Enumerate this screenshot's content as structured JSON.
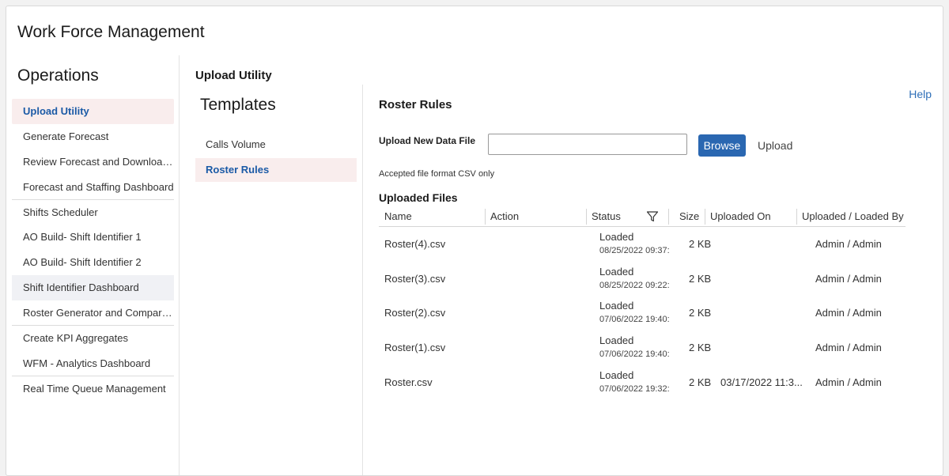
{
  "app": {
    "title": "Work Force Management"
  },
  "sidebar": {
    "title": "Operations",
    "items": [
      {
        "label": "Upload Utility"
      },
      {
        "label": "Generate Forecast"
      },
      {
        "label": "Review Forecast and Download Forecast"
      },
      {
        "label": "Forecast and Staffing Dashboard"
      },
      {
        "label": "Shifts Scheduler"
      },
      {
        "label": "AO Build- Shift Identifier 1"
      },
      {
        "label": "AO Build- Shift Identifier 2"
      },
      {
        "label": "Shift Identifier Dashboard"
      },
      {
        "label": "Roster Generator and Comparison"
      },
      {
        "label": "Create KPI Aggregates"
      },
      {
        "label": "WFM - Analytics Dashboard"
      },
      {
        "label": "Real Time Queue Management"
      }
    ]
  },
  "page": {
    "title": "Upload Utility",
    "help": "Help"
  },
  "templates": {
    "title": "Templates",
    "items": [
      {
        "label": "Calls Volume"
      },
      {
        "label": "Roster Rules"
      }
    ]
  },
  "upload": {
    "section_title": "Roster Rules",
    "label": "Upload New Data File",
    "file_value": "",
    "browse_label": "Browse",
    "upload_label": "Upload",
    "note": "Accepted file format CSV only"
  },
  "files": {
    "title": "Uploaded Files",
    "columns": [
      "Name",
      "Action",
      "Status",
      "Size",
      "Uploaded On",
      "Uploaded / Loaded By"
    ],
    "rows": [
      {
        "name": "Roster(4).csv",
        "status": "Loaded",
        "status_time": "08/25/2022 09:37:",
        "size": "2 KB",
        "uploaded_on": "",
        "by": "Admin / Admin"
      },
      {
        "name": "Roster(3).csv",
        "status": "Loaded",
        "status_time": "08/25/2022 09:22:",
        "size": "2 KB",
        "uploaded_on": "",
        "by": "Admin / Admin"
      },
      {
        "name": "Roster(2).csv",
        "status": "Loaded",
        "status_time": "07/06/2022 19:40:",
        "size": "2 KB",
        "uploaded_on": "",
        "by": "Admin / Admin"
      },
      {
        "name": "Roster(1).csv",
        "status": "Loaded",
        "status_time": "07/06/2022 19:40:",
        "size": "2 KB",
        "uploaded_on": "",
        "by": "Admin / Admin"
      },
      {
        "name": "Roster.csv",
        "status": "Loaded",
        "status_time": "07/06/2022 19:32:",
        "size": "2 KB",
        "uploaded_on": "03/17/2022 11:3...",
        "by": "Admin / Admin"
      }
    ]
  },
  "colors": {
    "accent": "#1b5aa6",
    "button": "#2a67b1",
    "active_bg": "#f9eded",
    "hover_bg": "#f0f1f5",
    "link": "#2f6fb8"
  },
  "icons": {
    "filter": "filter-icon"
  }
}
